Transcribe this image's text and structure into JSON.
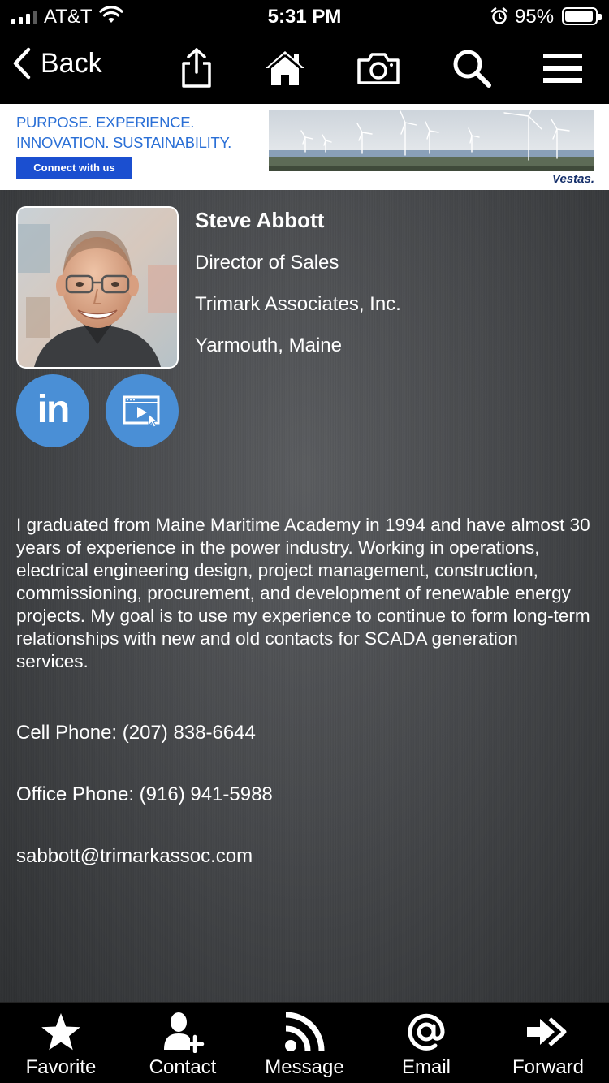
{
  "status_bar": {
    "carrier": "AT&T",
    "time": "5:31 PM",
    "battery": "95%"
  },
  "nav": {
    "back_label": "Back",
    "icons": [
      "share-icon",
      "home-icon",
      "camera-icon",
      "search-icon",
      "menu-icon"
    ]
  },
  "ad": {
    "line1": "PURPOSE. EXPERIENCE.",
    "line2": "INNOVATION. SUSTAINABILITY.",
    "button": "Connect with us",
    "brand": "Vestas.",
    "accent": "#2a6fd6"
  },
  "profile": {
    "name": "Steve Abbott",
    "title": "Director of Sales",
    "company": "Trimark Associates, Inc.",
    "location": "Yarmouth, Maine",
    "linkedin_label": "in",
    "bio": "I graduated from Maine Maritime Academy in 1994 and have almost 30 years of experience in the power industry. Working in operations, electrical engineering design, project management, construction, commissioning, procurement, and development of renewable energy projects. My goal is to use my experience to continue to form long-term relationships with new and old contacts for SCADA generation services.",
    "cell_phone": "Cell Phone: (207) 838-6644",
    "office_phone": "Office Phone: (916) 941-5988",
    "email": "sabbott@trimarkassoc.com",
    "button_color": "#4a8fd6"
  },
  "tabs": [
    {
      "label": "Favorite",
      "icon": "star-icon"
    },
    {
      "label": "Contact",
      "icon": "add-contact-icon"
    },
    {
      "label": "Message",
      "icon": "rss-icon"
    },
    {
      "label": "Email",
      "icon": "at-icon"
    },
    {
      "label": "Forward",
      "icon": "forward-icon"
    }
  ]
}
